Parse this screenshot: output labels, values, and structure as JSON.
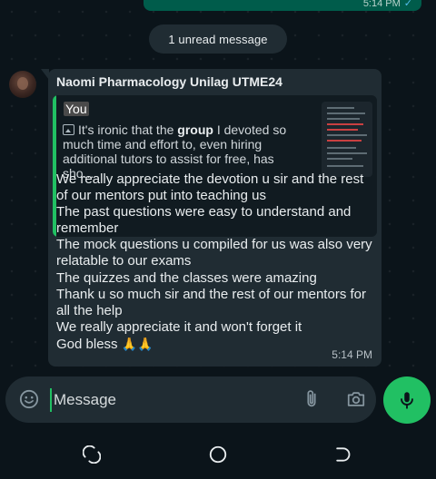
{
  "previous_message": {
    "time": "5:14 PM"
  },
  "unread_banner": "1 unread message",
  "message": {
    "sender": "Naomi Pharmacology Unilag UTME24",
    "quoted": {
      "author": "You",
      "text_before": "It's ironic that the ",
      "text_bold": "group",
      "text_after": " I devoted so much time and effort to, even hiring additional tutors to assist for free, has sho..."
    },
    "body_lines": [
      "We really appreciate the devotion u sir and the rest of our mentors put into teaching us",
      "The past questions were easy to understand and remember",
      "The mock questions u compiled for us was also very relatable to our exams",
      "The quizzes and the classes were amazing",
      "Thank u so much sir and the rest of our mentors for all the help",
      "We really appreciate it and won't forget it"
    ],
    "closing": "God bless",
    "closing_emoji": "🙏🙏",
    "time": "5:14 PM"
  },
  "input": {
    "placeholder": "Message"
  },
  "colors": {
    "accent": "#21c063",
    "bubble": "#202c33",
    "background": "#0b141a"
  }
}
